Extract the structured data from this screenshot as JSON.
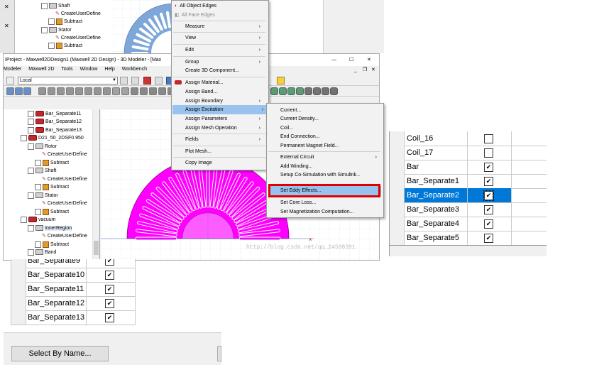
{
  "top_tree": [
    {
      "label": "Shaft",
      "indent": "1"
    },
    {
      "label": "CreateUserDefine",
      "indent": "2"
    },
    {
      "label": "Subtract",
      "indent": "2"
    },
    {
      "label": "Stator",
      "indent": "1"
    },
    {
      "label": "CreateUserDefine",
      "indent": "2"
    },
    {
      "label": "Subtract",
      "indent": "2"
    },
    {
      "label": "vacuum",
      "indent": "0"
    }
  ],
  "window": {
    "title": "IProject - Maxwell2DDesign1 (Maxwell 2D Design) - 3D Modeler - [Max",
    "menus": [
      "Modeler",
      "Maxwell 2D",
      "Tools",
      "Window",
      "Help",
      "Workbench"
    ],
    "coord_select": "Local",
    "controls": {
      "minimize": "—",
      "maximize": "☐",
      "close": "✕",
      "sub_minimize": "_",
      "sub_restore": "❐",
      "sub_close": "✕"
    }
  },
  "tree": [
    {
      "label": "Bar_Separate11"
    },
    {
      "label": "Bar_Separate12"
    },
    {
      "label": "Bar_Separate13"
    },
    {
      "label": "D21_50_2DSF0.950"
    },
    {
      "label": "Rotor"
    },
    {
      "label": "CreateUserDefine"
    },
    {
      "label": "Subtract"
    },
    {
      "label": "Shaft"
    },
    {
      "label": "CreateUserDefine"
    },
    {
      "label": "Subtract"
    },
    {
      "label": "Stator"
    },
    {
      "label": "CreateUserDefine"
    },
    {
      "label": "Subtract"
    },
    {
      "label": "vacuum"
    },
    {
      "label": "InnerRegion"
    },
    {
      "label": "CreateUserDefine"
    },
    {
      "label": "Subtract"
    },
    {
      "label": "Band"
    }
  ],
  "context_menu": {
    "items": [
      {
        "label": "All Object Edges",
        "submenu": false,
        "icon": "edge-icon"
      },
      {
        "label": "All Face Edges",
        "submenu": false,
        "icon": "face-icon"
      },
      {
        "label": "Measure",
        "submenu": true
      },
      {
        "label": "View",
        "submenu": true
      },
      {
        "label": "Edit",
        "submenu": true
      },
      {
        "label": "Group",
        "submenu": true
      },
      {
        "label": "Create 3D Component...",
        "submenu": false
      },
      {
        "label": "Assign Material...",
        "submenu": false,
        "icon": "material-icon"
      },
      {
        "label": "Assign Band...",
        "submenu": false
      },
      {
        "label": "Assign Boundary",
        "submenu": true
      },
      {
        "label": "Assign Excitation",
        "submenu": true,
        "highlighted": true
      },
      {
        "label": "Assign Parameters",
        "submenu": true
      },
      {
        "label": "Assign Mesh Operation",
        "submenu": true
      },
      {
        "label": "Fields",
        "submenu": true
      },
      {
        "label": "Plot Mesh...",
        "submenu": false
      },
      {
        "label": "Copy Image",
        "submenu": false
      }
    ]
  },
  "submenu": {
    "items": [
      {
        "label": "Current..."
      },
      {
        "label": "Current Density..."
      },
      {
        "label": "Coil..."
      },
      {
        "label": "End Connection..."
      },
      {
        "label": "Permanent Magnet Field..."
      },
      {
        "label": "External Circuit",
        "submenu": true
      },
      {
        "label": "Add Winding..."
      },
      {
        "label": "Setup Co-Simulation with Simulink..."
      },
      {
        "label": "Set Eddy Effects...",
        "highlighted": true
      },
      {
        "label": "Set Core Loss..."
      },
      {
        "label": "Set Magnetization Computation..."
      }
    ]
  },
  "watermark": "http://blog.csdn.net/qq_24598391",
  "right_table": [
    {
      "name": "Coil_16",
      "checked": false
    },
    {
      "name": "Coil_17",
      "checked": false
    },
    {
      "name": "Bar",
      "checked": true
    },
    {
      "name": "Bar_Separate1",
      "checked": true
    },
    {
      "name": "Bar_Separate2",
      "checked": true,
      "selected": true
    },
    {
      "name": "Bar_Separate3",
      "checked": true
    },
    {
      "name": "Bar_Separate4",
      "checked": true
    },
    {
      "name": "Bar_Separate5",
      "checked": true
    }
  ],
  "left_table": [
    {
      "name": "Bar_Separate9",
      "checked": true
    },
    {
      "name": "Bar_Separate10",
      "checked": true
    },
    {
      "name": "Bar_Separate11",
      "checked": true
    },
    {
      "name": "Bar_Separate12",
      "checked": true
    },
    {
      "name": "Bar_Separate13",
      "checked": true
    }
  ],
  "select_by_name_label": "Select By Name...",
  "colors": {
    "selection_blue": "#0078d7",
    "highlight_red": "#e00000",
    "magenta": "#ff00ff",
    "stator_blue": "#7da7d9"
  }
}
